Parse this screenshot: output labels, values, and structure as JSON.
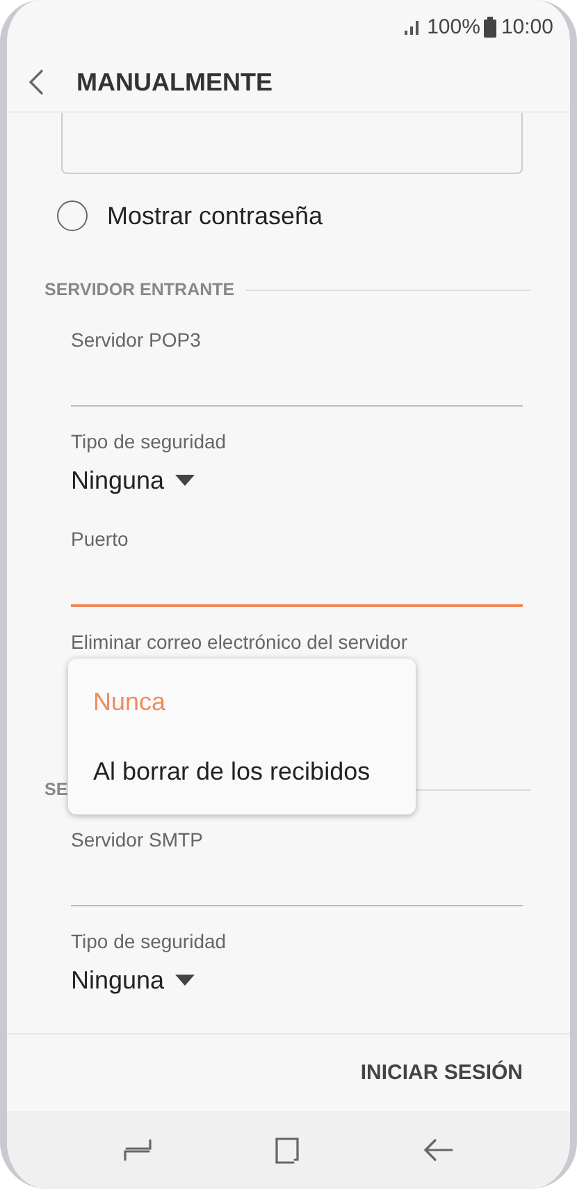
{
  "status_bar": {
    "battery": "100%",
    "time": "10:00"
  },
  "header": {
    "title": "MANUALMENTE"
  },
  "show_password": {
    "label": "Mostrar contraseña",
    "checked": false
  },
  "sections": [
    {
      "title": "SERVIDOR ENTRANTE",
      "fields": [
        {
          "kind": "text",
          "label": "Servidor POP3",
          "focused": false
        },
        {
          "kind": "select",
          "label": "Tipo de seguridad",
          "value": "Ninguna"
        },
        {
          "kind": "text",
          "label": "Puerto",
          "focused": true
        },
        {
          "kind": "label",
          "label": "Eliminar correo electrónico del servidor"
        }
      ]
    },
    {
      "title": "SE",
      "fields": [
        {
          "kind": "text",
          "label": "Servidor SMTP",
          "focused": false
        },
        {
          "kind": "select",
          "label": "Tipo de seguridad",
          "value": "Ninguna"
        }
      ]
    }
  ],
  "menu": [
    {
      "label": "Nunca",
      "selected": true
    },
    {
      "label": "Al borrar de los recibidos",
      "selected": false
    }
  ],
  "action": {
    "label": "INICIAR SESIÓN"
  }
}
